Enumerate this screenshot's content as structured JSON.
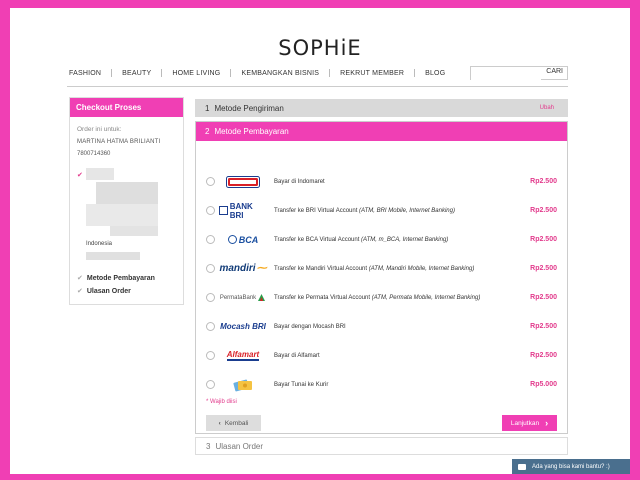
{
  "brand": {
    "logo_text": "SOPHiE"
  },
  "nav": {
    "items": [
      "FASHION",
      "BEAUTY",
      "HOME LIVING",
      "KEMBANGKAN BISNIS",
      "REKRUT MEMBER",
      "BLOG"
    ],
    "search_placeholder": "",
    "search_button": "CARI"
  },
  "sidebar": {
    "title": "Checkout Proses",
    "order_for_label": "Order ini untuk:",
    "customer_name": "MARTINA HATMA BRILIANTI",
    "customer_phone": "7800714360",
    "country": "Indonesia",
    "steps": [
      {
        "label": "Metode Pembayaran"
      },
      {
        "label": "Ulasan Order"
      }
    ]
  },
  "steps": {
    "step1": {
      "number": "1",
      "title": "Metode Pengiriman",
      "edit_label": "Ubah"
    },
    "step2": {
      "number": "2",
      "title": "Metode Pembayaran"
    },
    "step3": {
      "number": "3",
      "title": "Ulasan Order"
    }
  },
  "payment_methods": [
    {
      "logo": "Indomaret",
      "label": "Bayar di Indomaret",
      "detail": "",
      "price": "Rp2.500"
    },
    {
      "logo": "BANK BRI",
      "label": "Transfer ke BRI Virtual Account ",
      "detail": "(ATM, BRI Mobile, Internet Banking)",
      "price": "Rp2.500"
    },
    {
      "logo": "BCA",
      "label": "Transfer ke BCA Virtual Account ",
      "detail": "(ATM, m_BCA, Internet Banking)",
      "price": "Rp2.500"
    },
    {
      "logo": "mandiri",
      "label": "Transfer ke Mandiri Virtual Account ",
      "detail": "(ATM, Mandiri Mobile, Internet Banking)",
      "price": "Rp2.500"
    },
    {
      "logo": "PermataBank",
      "label": "Transfer ke Permata Virtual Account ",
      "detail": "(ATM, Permata Mobile, Internet Banking)",
      "price": "Rp2.500"
    },
    {
      "logo": "Mocash BRI",
      "label": "Bayar dengan Mocash BRI",
      "detail": "",
      "price": "Rp2.500"
    },
    {
      "logo": "Alfamart",
      "label": "Bayar di Alfamart",
      "detail": "",
      "price": "Rp2.500"
    },
    {
      "logo": "kurir",
      "label": "Bayar Tunai ke Kurir",
      "detail": "",
      "price": "Rp5.000"
    }
  ],
  "form": {
    "required_note": "* Wajib diisi",
    "back_button": "Kembali",
    "next_button": "Lanjutkan"
  },
  "chat": {
    "label": "Ada yang bisa kami bantu? :)"
  },
  "colors": {
    "accent": "#f03fb4",
    "price": "#e23a8c",
    "chat": "#4a6f8e"
  }
}
